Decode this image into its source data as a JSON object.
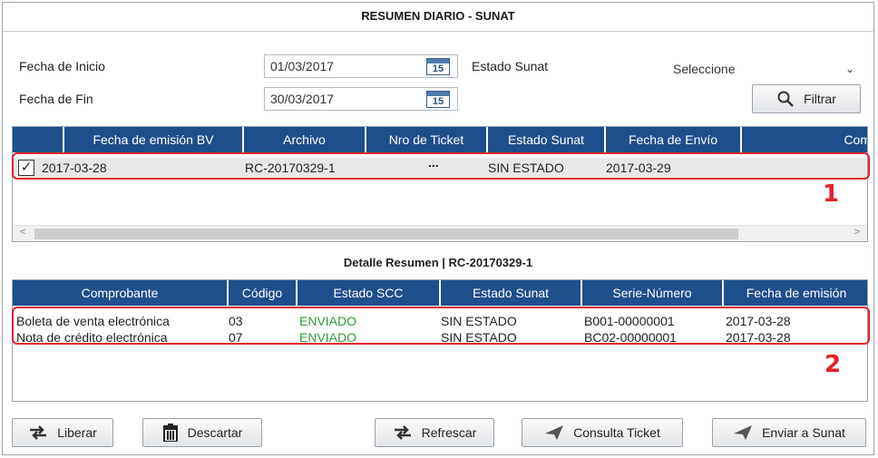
{
  "window": {
    "title": "RESUMEN DIARIO - SUNAT"
  },
  "filters": {
    "fecha_inicio_label": "Fecha de Inicio",
    "fecha_inicio_value": "01/03/2017",
    "fecha_fin_label": "Fecha de Fin",
    "fecha_fin_value": "30/03/2017",
    "calendar_day": "15",
    "estado_label": "Estado Sunat",
    "estado_value": "Seleccione",
    "filtrar_label": "Filtrar"
  },
  "summary_grid": {
    "columns": [
      "",
      "Fecha de emisión BV",
      "Archivo",
      "Nro de Ticket",
      "Estado Sunat",
      "Fecha de Envío",
      "Com"
    ],
    "rows": [
      {
        "checked": true,
        "fecha_emision": "2017-03-28",
        "archivo": "RC-20170329-1",
        "nro_ticket": "...",
        "estado_sunat": "SIN ESTADO",
        "fecha_envio": "2017-03-29"
      }
    ]
  },
  "detail": {
    "title": "Detalle Resumen | RC-20170329-1",
    "columns": [
      "Comprobante",
      "Código",
      "Estado SCC",
      "Estado Sunat",
      "Serie-Número",
      "Fecha de emisión"
    ],
    "rows": [
      {
        "comprobante": "Boleta de venta electrónica",
        "codigo": "03",
        "estado_scc": "ENVIADO",
        "estado_sunat": "SIN ESTADO",
        "serie_numero": "B001-00000001",
        "fecha_emision": "2017-03-28"
      },
      {
        "comprobante": "Nota de crédito electrónica",
        "codigo": "07",
        "estado_scc": "ENVIADO",
        "estado_sunat": "SIN ESTADO",
        "serie_numero": "BC02-00000001",
        "fecha_emision": "2017-03-28"
      }
    ]
  },
  "annotations": {
    "callout_1": "1",
    "callout_2": "2"
  },
  "buttons": {
    "liberar": "Liberar",
    "descartar": "Descartar",
    "refrescar": "Refrescar",
    "consulta_ticket": "Consulta Ticket",
    "enviar_sunat": "Enviar a Sunat"
  },
  "colors": {
    "header_bg": "#1f4e8c",
    "enviado": "#2e9a3a",
    "callout": "#e2202a"
  }
}
